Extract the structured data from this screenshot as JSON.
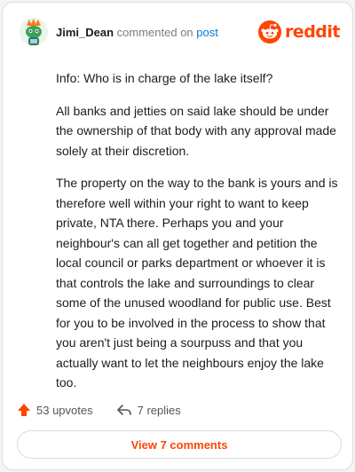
{
  "header": {
    "username": "Jimi_Dean",
    "action_text": "commented on",
    "post_link": "post",
    "brand": "reddit",
    "brand_color": "#ff4500",
    "avatar_icon": "snoo-avatar-icon"
  },
  "comment": {
    "paragraphs": [
      "Info: Who is in charge of the lake itself?",
      "All banks and jetties on said lake should be under the ownership of that body with any approval made solely at their discretion.",
      "The property on the way to the bank is yours and is therefore well within your right to want to keep private, NTA there. Perhaps you and your neighbour's can all get together and petition the local council or parks department or whoever it is that controls the lake and surroundings to clear some of the unused woodland for public use. Best for you to be involved in the process to show that you aren't just being a sourpuss and that you actually want to let the neighbours enjoy the lake too."
    ]
  },
  "footer": {
    "upvotes": "53 upvotes",
    "replies": "7 replies",
    "view_button": "View 7 comments",
    "upvote_icon": "upvote-arrow-icon",
    "reply_icon": "reply-arrow-icon"
  }
}
